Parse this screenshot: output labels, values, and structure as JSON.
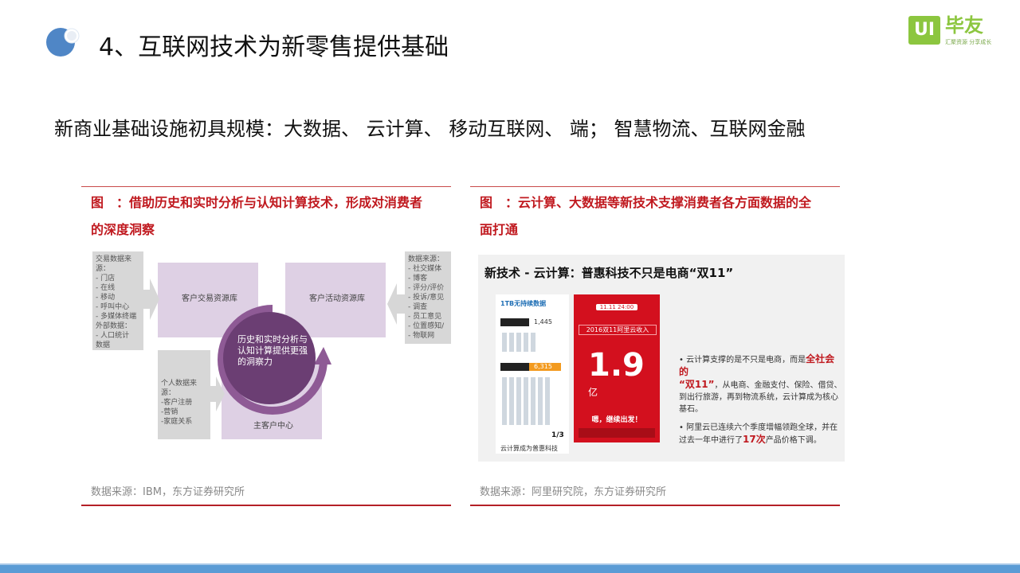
{
  "header": {
    "title": "4、互联网技术为新零售提供基础",
    "logo_mark": "UI",
    "logo_name": "毕友",
    "logo_tag": "汇聚资源 分享成长"
  },
  "subtitle": "新商业基础设施初具规模：大数据、 云计算、 移动互联网、 端； 智慧物流、互联网金融",
  "colors": {
    "accent_blue": "#5b9bd5",
    "caption_red": "#c0191f",
    "logo_green": "#8cc63f",
    "purple_light": "#ded0e4",
    "purple_dark": "#6b3e73"
  },
  "left_figure": {
    "caption_line1": "图　：借助历史和实时分析与认知计算技术，形成对消费者",
    "caption_line2": "的深度洞察",
    "source": "数据来源：IBM，东方证券研究所",
    "box_transaction": "客户交易资源库",
    "box_activity": "客户活动资源库",
    "box_master": "主客户中心",
    "center_text": [
      "历史和实时分析与",
      "认知计算提供更强",
      "的洞察力"
    ],
    "left_sources_title": "交易数据来源：",
    "left_sources": [
      "- 门店",
      "- 在线",
      "- 移动",
      "- 呼叫中心",
      "- 多媒体终端"
    ],
    "external_title": "外部数据：",
    "external_sources": [
      "- 人口统计",
      "  数据",
      "- 天气数据",
      "- 人口调查",
      "- 物联网"
    ],
    "personal_title": "个人数据来源：",
    "personal_sources": [
      "-客户注册",
      "-营销",
      "-家庭关系"
    ],
    "right_sources_title": "数据来源：",
    "right_sources": [
      "- 社交媒体",
      "- 博客",
      "- 评分/评价",
      "- 投诉/意见",
      "- 调查",
      "- 员工意见",
      "- 位置感知/",
      "  服务",
      "- 物联网"
    ]
  },
  "right_figure": {
    "caption_line1": "图　：云计算、大数据等新技术支撑消费者各方面数据的全",
    "caption_line2": "面打通",
    "source": "数据来源：阿里研究院，东方证券研究所",
    "slide_title": "新技术 - 云计算：普惠科技不只是电商“双11”",
    "promo_date": "11.11 24:00",
    "promo_label": "2016双11阿里云收入",
    "promo_value": "1.9",
    "promo_unit": "亿",
    "promo_note": "嗯，继续出发！",
    "infographic_title": "1TB无持续数据",
    "infographic_caption": "云计算成为普惠科技",
    "infographic_v1": "1,445",
    "infographic_v2": "6,315",
    "infographic_ratio": "1/3",
    "bullet1_a": "云计算支撑的是不只是电商，而是",
    "bullet1_hl": "全社会的",
    "bullet1_hl2": "“双11”",
    "bullet1_b": "，从电商、金融支付、保险、借贷、到出行旅游，再到物流系统，云计算成为核心基石。",
    "bullet2_a": "阿里云已连续六个季度增幅领跑全球，并在过去一年中进行了",
    "bullet2_hl": "17次",
    "bullet2_b": "产品价格下调。"
  }
}
